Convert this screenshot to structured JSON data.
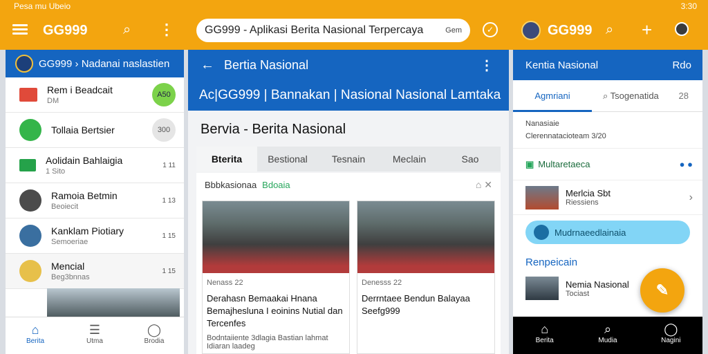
{
  "status_bar": {
    "left": "Pesa mu Ubeio",
    "right_time": "3:30"
  },
  "app_bar": {
    "brand_left": "GG999",
    "url_title": "GG999 - Aplikasi Berita Nasional Terpercaya",
    "url_site": "Gem",
    "brand_right": "GG999"
  },
  "left_panel": {
    "header": "GG999 › Nadanai naslastien",
    "items": [
      {
        "title": "Rem i Beadcait",
        "sub": "DM",
        "meta": "A50"
      },
      {
        "title": "Tollaia Bertsier",
        "sub": "",
        "meta": "300"
      },
      {
        "title": "Aolidain Bahlaigia",
        "sub": "1 Sito",
        "meta": "1 11"
      },
      {
        "title": "Ramoia Betmin",
        "sub": "Beoiecit",
        "meta": "1 13"
      },
      {
        "title": "Kanklam Piotiary",
        "sub": "Semoeriae",
        "meta": "1 15"
      },
      {
        "title": "Mencial",
        "sub": "Beg3bnnas",
        "meta": "1 15"
      }
    ],
    "bottom_nav": [
      {
        "label": "Berita",
        "active": true
      },
      {
        "label": "Utma",
        "active": false
      },
      {
        "label": "Brodia",
        "active": false
      }
    ]
  },
  "middle_panel": {
    "top_title": "Bertia Nasional",
    "banner": "Ac|GG999 | Bannakan | Nasional Nasional Lamtaka",
    "page_title": "Bervia - Berita Nasional",
    "tabs": [
      "Bterita",
      "Bestional",
      "Tesnain",
      "Meclain",
      "Sao"
    ],
    "card": {
      "header": "Bbbkasionaa",
      "header_green": "Bdoaia",
      "articles": [
        {
          "date": "Nenass 22",
          "headline": "Derahasn Bemaakai Hnana Bemajhesluna I eoinins Nutial dan Tercenfes",
          "foot": "Bodntaiiente 3dlagia Bastian lahmat Idiaran laadeg"
        },
        {
          "date": "Denesss 22",
          "headline": "Derrntaee Bendun Balayaa Seefg999",
          "foot": ""
        }
      ]
    }
  },
  "right_panel": {
    "header_title": "Kentia Nasional",
    "header_right": "Rdo",
    "tabs": {
      "active": "Agmriani",
      "other": "Tsogenatida",
      "badge": "28"
    },
    "note_lines": [
      "Nanasiaie",
      "Clerennatacioteam 3/20"
    ],
    "row_green_title": "Multaretaeca",
    "item1": {
      "title": "Merlcia Sbt",
      "sub": "Riessiens"
    },
    "highlight": "Mudrnaeedlainaia",
    "section": "Renpeicain",
    "item2": {
      "title": "Nemia Nasional",
      "sub": "Tociast"
    },
    "bottom_nav": [
      "Berita",
      "Mudia",
      "Nagini"
    ]
  },
  "icons": {
    "menu": "menu-icon",
    "search": "search-icon",
    "more": "more-icon",
    "shield": "shield-icon",
    "back": "back-arrow-icon",
    "add": "add-icon"
  },
  "colors": {
    "accent": "#f3a50f",
    "primary": "#1565c0",
    "green": "#26a65b"
  }
}
